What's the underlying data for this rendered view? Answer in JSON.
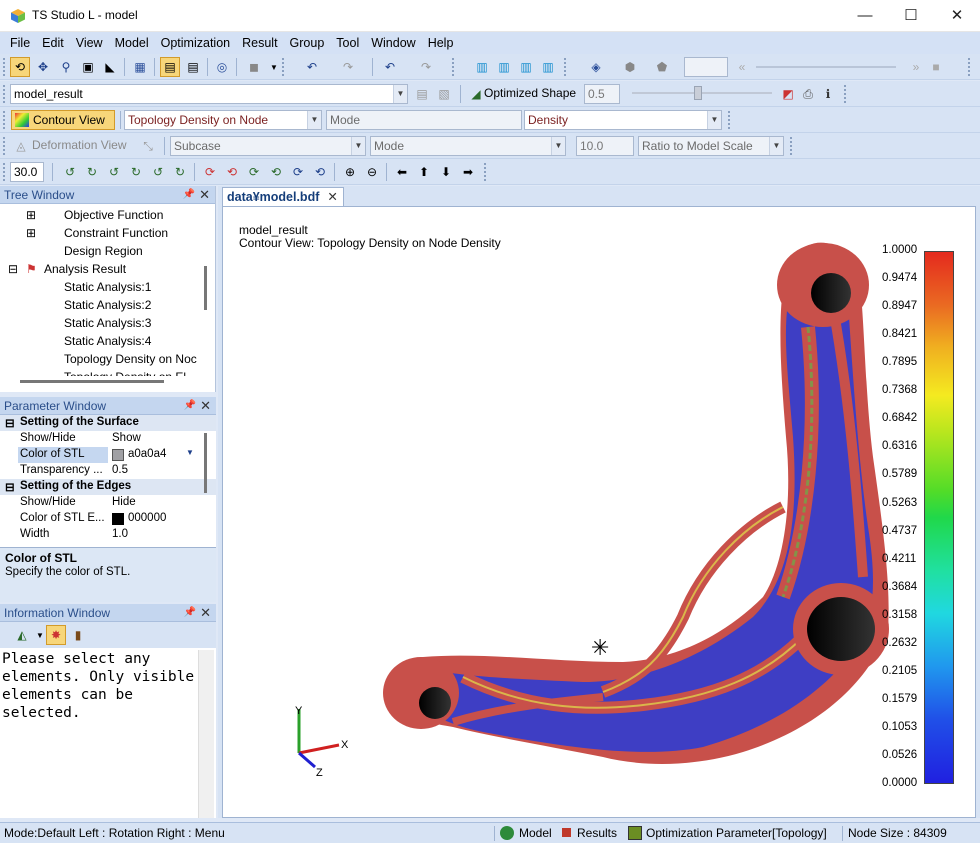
{
  "window": {
    "title": "TS Studio L - model",
    "minimize": "—",
    "maximize": "☐",
    "close": "✕"
  },
  "menu": [
    "File",
    "Edit",
    "View",
    "Model",
    "Optimization",
    "Result",
    "Group",
    "Tool",
    "Window",
    "Help"
  ],
  "toolbar2": {
    "result_name": "model_result",
    "optimized_shape_label": "Optimized Shape",
    "threshold": "0.5"
  },
  "toolbar3": {
    "contour_view_label": "Contour View",
    "result_type": "Topology Density on Node",
    "mode": "Mode",
    "component": "Density"
  },
  "toolbar4": {
    "deformation_view_label": "Deformation View",
    "subcase": "Subcase",
    "mode": "Mode",
    "scale": "10.0",
    "scale_mode": "Ratio to Model Scale"
  },
  "toolbar5": {
    "angle": "30.0"
  },
  "tree_window": {
    "title": "Tree Window",
    "items": [
      "Objective Function",
      "Constraint Function",
      "Design Region",
      "Analysis Result",
      "Static Analysis:1",
      "Static Analysis:2",
      "Static Analysis:3",
      "Static Analysis:4",
      "Topology Density on Noc",
      "Topology Density on El"
    ]
  },
  "parameter_window": {
    "title": "Parameter Window",
    "group1": "Setting of the Surface",
    "rows1": [
      {
        "key": "Show/Hide",
        "value": "Show"
      },
      {
        "key": "Color of STL",
        "value": "a0a0a4"
      },
      {
        "key": "Transparency ...",
        "value": "0.5"
      }
    ],
    "group2": "Setting of the Edges",
    "rows2": [
      {
        "key": "Show/Hide",
        "value": "Hide"
      },
      {
        "key": "Color of STL E...",
        "value": "000000"
      },
      {
        "key": "Width",
        "value": "1.0"
      }
    ],
    "desc_title": "Color of STL",
    "desc_text": "Specify the color of STL."
  },
  "info_window": {
    "title": "Information Window",
    "message": "Please select any elements. Only visible elements can be selected."
  },
  "document": {
    "tab": "data¥model.bdf",
    "heading1": "model_result",
    "heading2": "Contour View: Topology Density on Node Density"
  },
  "axes": {
    "x": "X",
    "y": "Y",
    "z": "Z"
  },
  "legend": {
    "labels": [
      "1.0000",
      "0.9474",
      "0.8947",
      "0.8421",
      "0.7895",
      "0.7368",
      "0.6842",
      "0.6316",
      "0.5789",
      "0.5263",
      "0.4737",
      "0.4211",
      "0.3684",
      "0.3158",
      "0.2632",
      "0.2105",
      "0.1579",
      "0.1053",
      "0.0526",
      "0.0000"
    ]
  },
  "status": {
    "mode": "Mode:Default  Left : Rotation Right : Menu",
    "model": "Model",
    "results": "Results",
    "opt_param": "Optimization Parameter[Topology]",
    "node_size": "Node Size : 84309"
  },
  "colors": {
    "accent": "#1f4e9a",
    "density_high": "#c8504a",
    "density_low": "#3e3ec4"
  }
}
